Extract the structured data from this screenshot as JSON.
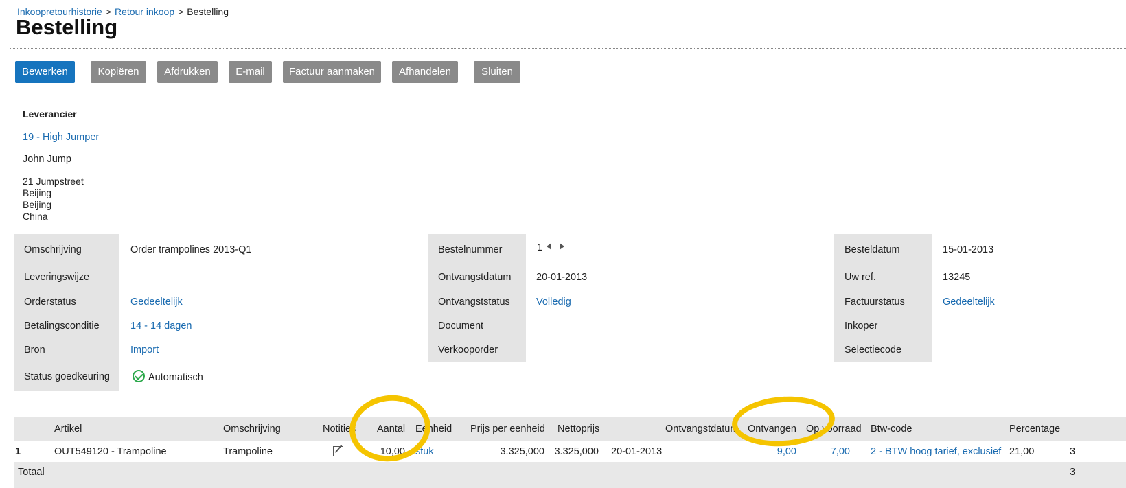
{
  "breadcrumb": {
    "item1": "Inkoopretourhistorie",
    "sep": ">",
    "item2": "Retour inkoop",
    "current": "Bestelling"
  },
  "page_title": "Bestelling",
  "toolbar": {
    "edit": "Bewerken",
    "copy": "Kopiëren",
    "print": "Afdrukken",
    "email": "E-mail",
    "create_invoice": "Factuur aanmaken",
    "complete": "Afhandelen",
    "close": "Sluiten"
  },
  "supplier": {
    "label": "Leverancier",
    "code": "19 - High Jumper",
    "contact": "John Jump",
    "address": [
      "21 Jumpstreet",
      "Beijing",
      "Beijing",
      "China"
    ]
  },
  "fields": {
    "omschrijving": {
      "label": "Omschrijving",
      "value": "Order trampolines 2013-Q1"
    },
    "leveringswijze": {
      "label": "Leveringswijze",
      "value": ""
    },
    "orderstatus": {
      "label": "Orderstatus",
      "value": "Gedeeltelijk"
    },
    "betalingsconditie": {
      "label": "Betalingsconditie",
      "value": "14 - 14 dagen"
    },
    "bron": {
      "label": "Bron",
      "value": "Import"
    },
    "status_goedkeuring": {
      "label": "Status goedkeuring",
      "value": "Automatisch"
    },
    "bestelnummer": {
      "label": "Bestelnummer",
      "value": "1"
    },
    "ontvangstdatum": {
      "label": "Ontvangstdatum",
      "value": "20-01-2013"
    },
    "ontvangststatus": {
      "label": "Ontvangststatus",
      "value": "Volledig"
    },
    "document": {
      "label": "Document",
      "value": ""
    },
    "verkooporder": {
      "label": "Verkooporder",
      "value": ""
    },
    "besteldatum": {
      "label": "Besteldatum",
      "value": "15-01-2013"
    },
    "uw_ref": {
      "label": "Uw ref.",
      "value": "13245"
    },
    "factuurstatus": {
      "label": "Factuurstatus",
      "value": "Gedeeltelijk"
    },
    "inkoper": {
      "label": "Inkoper",
      "value": ""
    },
    "selectiecode": {
      "label": "Selectiecode",
      "value": ""
    }
  },
  "lines": {
    "headers": {
      "artikel": "Artikel",
      "omschrijving": "Omschrijving",
      "notities": "Notities",
      "aantal": "Aantal",
      "eenheid": "Eenheid",
      "prijs": "Prijs per eenheid",
      "netto": "Nettoprijs",
      "ontvangstdatum": "Ontvangstdatum",
      "ontvangen": "Ontvangen",
      "op_voorraad": "Op voorraad",
      "btw": "Btw-code",
      "percentage": "Percentage"
    },
    "row": {
      "nr": "1",
      "artikel": "OUT549120 - Trampoline",
      "omschrijving": "Trampoline",
      "aantal": "10,00",
      "eenheid": "stuk",
      "prijs": "3.325,000",
      "netto": "3.325,000",
      "datum": "20-01-2013",
      "ontvangen": "9,00",
      "op_voorraad": "7,00",
      "btw": "2 - BTW hoog tarief, exclusief",
      "percentage": "21,00",
      "extra": "3"
    },
    "total_label": "Totaal",
    "total_extra": "3"
  },
  "colors": {
    "primary_button": "#1674be",
    "secondary_button": "#8a8a8a",
    "link": "#1a6bb0",
    "highlight": "#f5c400"
  }
}
